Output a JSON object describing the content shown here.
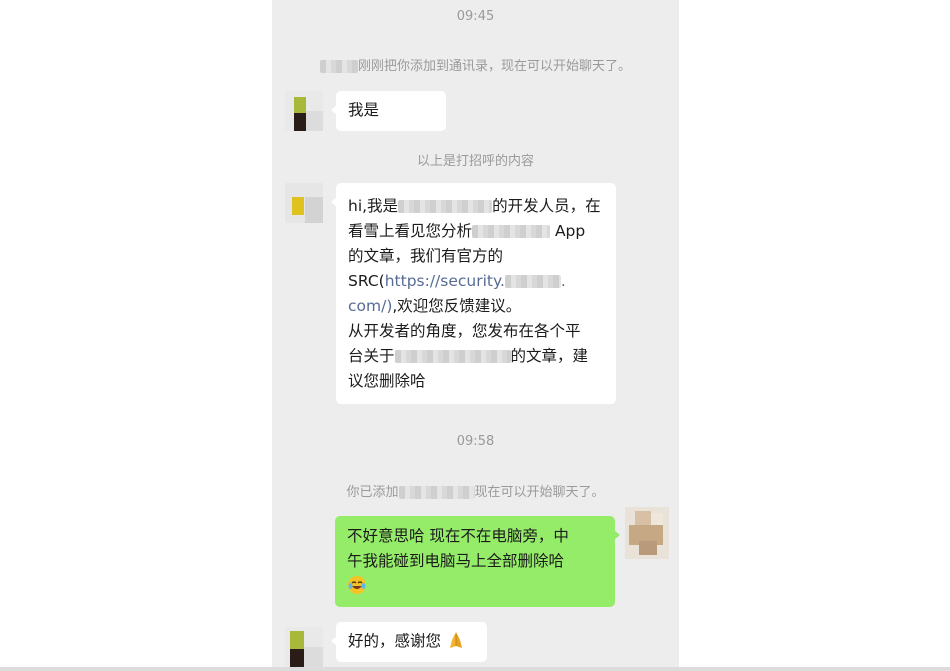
{
  "timestamps": [
    "09:45",
    "09:58"
  ],
  "system_messages": {
    "added_contact": "刚刚把你添加到通讯录，现在可以开始聊天了。",
    "greeting_divider": "以上是打招呼的内容",
    "added_prefix": "你已添加",
    "added_suffix": "现在可以开始聊天了。"
  },
  "messages": [
    {
      "side": "left",
      "text": "我是"
    },
    {
      "side": "left",
      "lines": [
        {
          "a": "hi,我是",
          "b": "的开发人员，在"
        },
        {
          "a": "看雪上看见您分析",
          "b": "App"
        },
        {
          "a": "的文章，我们有官方的"
        },
        {
          "a": "SRC(",
          "link": "https://security.",
          "b": "."
        },
        {
          "link": "com/)",
          "a": ",欢迎您反馈建议。"
        },
        {
          "a": "从开发者的角度，您发布在各个平"
        },
        {
          "a": "台关于",
          "b": "的文章，建"
        },
        {
          "a": "议您删除哈"
        }
      ]
    },
    {
      "side": "right",
      "lines": [
        "不好意思哈 现在不在电脑旁，中",
        "午我能碰到电脑马上全部删除哈"
      ],
      "emoji": "laughing-crying-emoji"
    },
    {
      "side": "left",
      "text": "好的，感谢您",
      "emoji": "praying-hands-emoji"
    }
  ],
  "colors": {
    "chat_background": "#ededed",
    "own_bubble": "#95ec69",
    "other_bubble": "#ffffff",
    "link": "#576b95",
    "system_text": "#9a9a9a"
  }
}
